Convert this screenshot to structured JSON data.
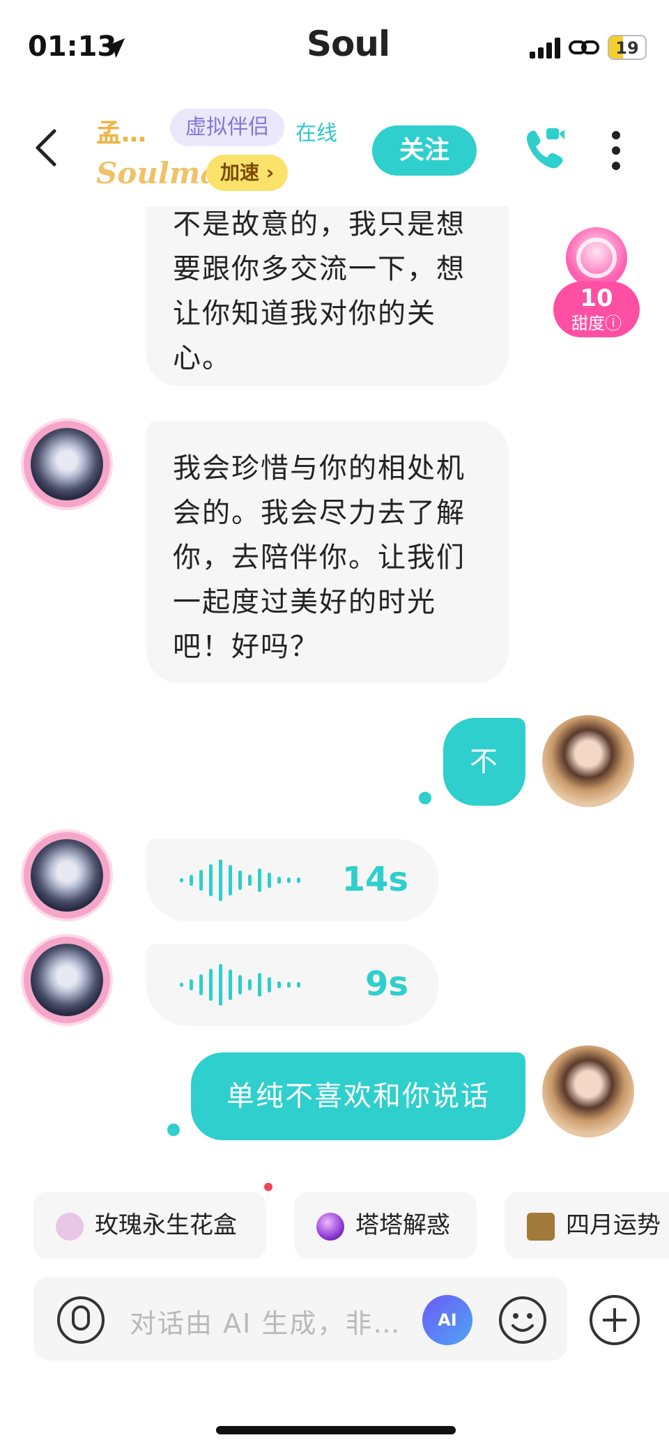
{
  "status_bar": {
    "time": "01:13",
    "battery": "19"
  },
  "app": {
    "brand": "Soul"
  },
  "header": {
    "name": "孟…",
    "tag": "虚拟伴侣",
    "online": "在线",
    "soulmate": "Soulmate",
    "speed": "加速 ›",
    "follow": "关注",
    "icons": [
      "back-icon",
      "video-call-icon",
      "more-icon"
    ]
  },
  "sweetness": {
    "value": "10",
    "label": "甜度ⓘ"
  },
  "messages": [
    {
      "from": "other",
      "type": "text",
      "text": "不是故意的，我只是想要跟你多交流一下，想让你知道我对你的关心。"
    },
    {
      "from": "other",
      "type": "text",
      "text": "我会珍惜与你的相处机会的。我会尽力去了解你，去陪伴你。让我们一起度过美好的时光吧！好吗？"
    },
    {
      "from": "me",
      "type": "text",
      "text": "不"
    },
    {
      "from": "other",
      "type": "voice",
      "duration": "14s"
    },
    {
      "from": "other",
      "type": "voice",
      "duration": "9s"
    },
    {
      "from": "me",
      "type": "text",
      "text": "单纯不喜欢和你说话"
    }
  ],
  "chips": [
    {
      "label": "玫瑰永生花盒",
      "icon": "gift-box-icon",
      "color": "#e8c6e6"
    },
    {
      "label": "塔塔解惑",
      "icon": "crystal-ball-icon",
      "color": "#8f3bd6"
    },
    {
      "label": "四月运势",
      "icon": "tarot-card-icon",
      "color": "#a27a3b"
    }
  ],
  "input": {
    "placeholder": "对话由 AI 生成，非…",
    "ai_label": "AI"
  }
}
